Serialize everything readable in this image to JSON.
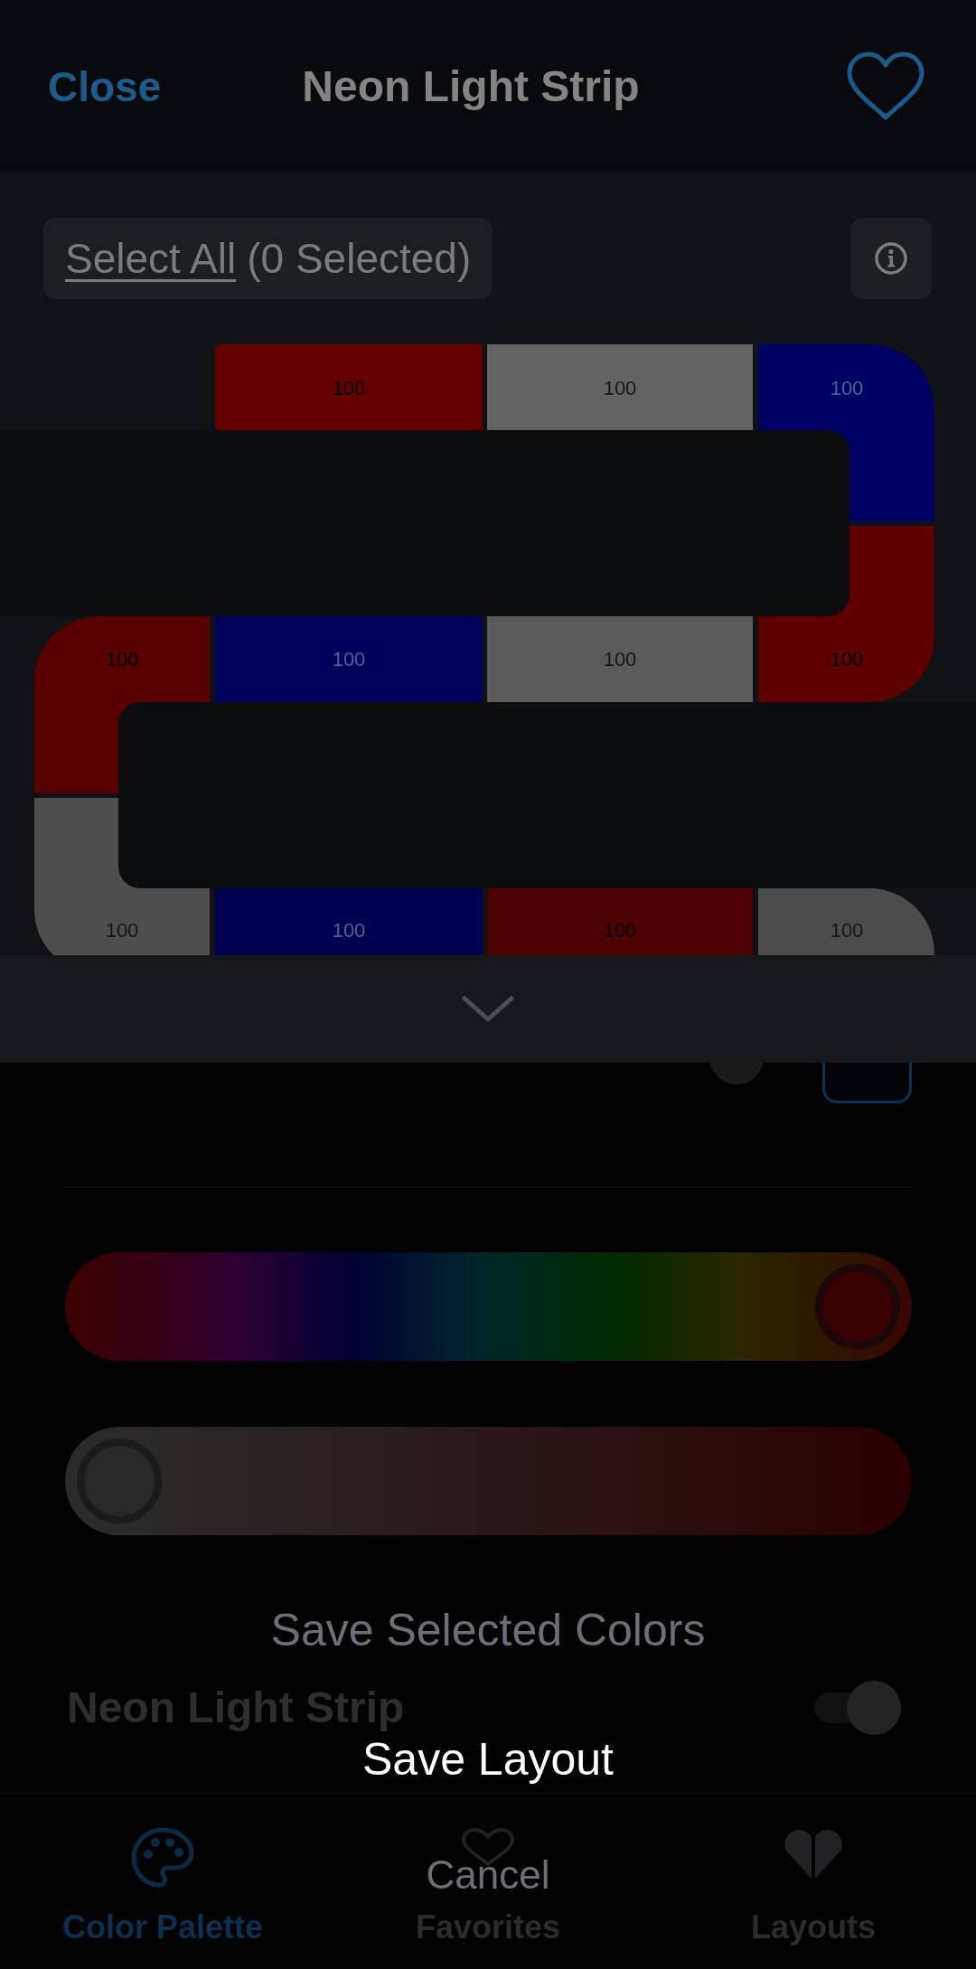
{
  "header": {
    "close": "Close",
    "title": "Neon Light Strip"
  },
  "toolbar": {
    "select_all": "Select All",
    "selected_count": "(0 Selected)"
  },
  "strip": {
    "segments": [
      {
        "value": "100",
        "color": "#650000"
      },
      {
        "value": "100",
        "color": "#636363"
      },
      {
        "value": "100",
        "color": "#000064"
      },
      {
        "value": "100",
        "color": "#580000"
      },
      {
        "value": "100",
        "color": "#00005a"
      },
      {
        "value": "100",
        "color": "#5a5a5a"
      },
      {
        "value": "100",
        "color": "#5e0000"
      },
      {
        "value": "100",
        "color": "#4e4e4e"
      },
      {
        "value": "100",
        "color": "#000050"
      },
      {
        "value": "100",
        "color": "#4c0000"
      },
      {
        "value": "100",
        "color": "#4c4c4c"
      }
    ]
  },
  "color_slider": {
    "level": 1
  },
  "shade_slider": {
    "level": 0
  },
  "background": {
    "title": "Neon Light Strip",
    "toggle": {
      "on": true
    },
    "tabs": [
      {
        "label": "Color Palette",
        "selected": true
      },
      {
        "label": "Favorites",
        "selected": false
      },
      {
        "label": "Layouts",
        "selected": false
      }
    ]
  },
  "action_sheet": {
    "actions": [
      {
        "label": "Save Selected Colors",
        "disabled": true
      },
      {
        "label": "Save Layout",
        "disabled": false
      }
    ],
    "cancel": "Cancel"
  }
}
